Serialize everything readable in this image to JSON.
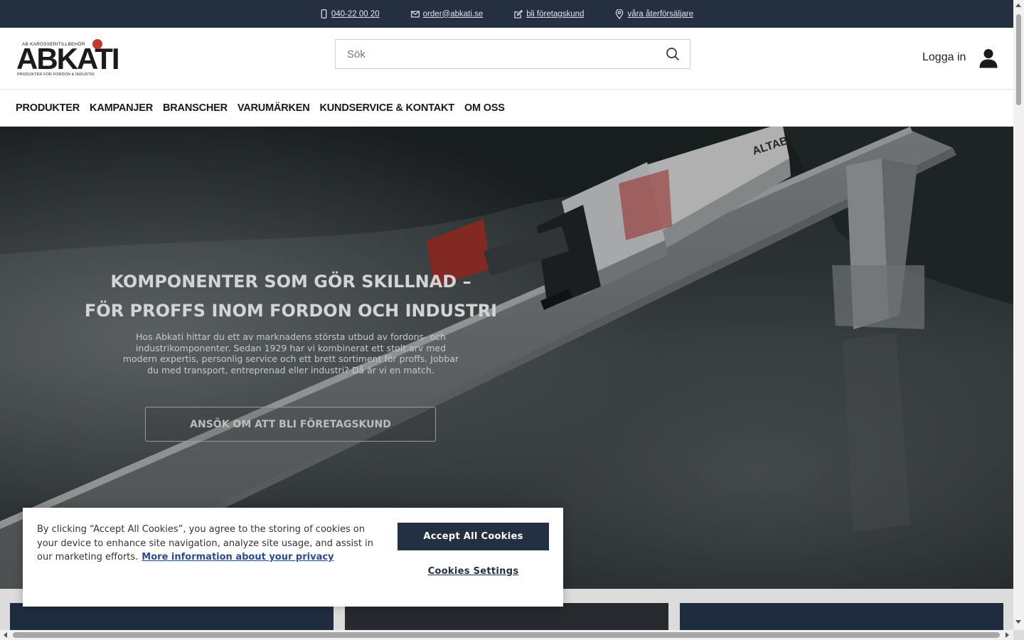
{
  "topbar": {
    "phone": "040-22 00 20",
    "email": "order@abkati.se",
    "become_customer": "bli företagskund",
    "resellers": "våra återförsäljare"
  },
  "header": {
    "logo": {
      "tagline": "AB KAROSSERITILLBEHÖR",
      "wordmark": "ABKATI",
      "subline": "PRODUKTER FÖR FORDON & INDUSTRI"
    },
    "search_placeholder": "Sök",
    "login_label": "Logga in"
  },
  "nav": {
    "items": [
      "PRODUKTER",
      "KAMPANJER",
      "BRANSCHER",
      "VARUMÄRKEN",
      "KUNDSERVICE & KONTAKT",
      "OM OSS"
    ]
  },
  "hero": {
    "title_line1": "KOMPONENTER SOM GÖR SKILLNAD –",
    "title_line2": "FÖR PROFFS INOM FORDON OCH INDUSTRI",
    "text": "Hos Abkati hittar du ett av marknadens största utbud av fordons- och industrikomponenter. Sedan 1929 har vi kombinerat ett stolt arv med modern expertis, personlig service och ett brett sortiment för proffs. Jobbar du med transport, entreprenad eller industri? Då är vi en match.",
    "cta": "ANSÖK OM ATT BLI FÖRETAGSKUND",
    "truck_brand": "ALTAB"
  },
  "cookie": {
    "text": "By clicking “Accept All Cookies”, you agree to the storing of cookies on your device to enhance site navigation, analyze site usage, and assist in our marketing efforts.",
    "privacy_link": "More information about your privacy",
    "accept": "Accept All Cookies",
    "settings": "Cookies Settings"
  },
  "colors": {
    "topbar_bg": "#243040",
    "accent_dark": "#233041",
    "logo_dot": "#c23a2a",
    "link_blue": "#2a4a8f"
  },
  "icons": {
    "phone": "phone-icon",
    "email": "mail-icon",
    "become_customer": "edit-icon",
    "resellers": "location-pin-icon",
    "search": "search-icon",
    "user": "user-icon"
  }
}
